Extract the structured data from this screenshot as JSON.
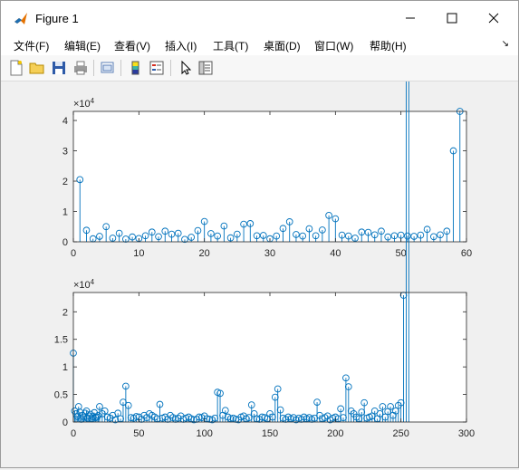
{
  "window": {
    "title": "Figure 1"
  },
  "menu": [
    "文件(F)",
    "编辑(E)",
    "查看(V)",
    "插入(I)",
    "工具(T)",
    "桌面(D)",
    "窗口(W)",
    "帮助(H)"
  ],
  "toolbar": [
    "new-figure-icon",
    "open-file-icon",
    "save-icon",
    "print-icon",
    "link-plot-icon",
    "colorbar-icon",
    "legend-icon",
    "pointer-icon",
    "property-inspector-icon"
  ],
  "colors": {
    "series": "#0072bd",
    "axes_bg": "#ffffff",
    "figure_bg": "#f0f0f0"
  },
  "chart_data": [
    {
      "type": "stem",
      "exponent_label": "×10",
      "exponent_power": "4",
      "xlim": [
        0,
        60
      ],
      "ylim": [
        0,
        43000
      ],
      "xticks": [
        0,
        10,
        20,
        30,
        40,
        50,
        60
      ],
      "yticks": [
        0,
        10000,
        20000,
        30000,
        40000
      ],
      "xtick_labels": [
        "0",
        "10",
        "20",
        "30",
        "40",
        "50",
        "60"
      ],
      "ytick_labels": [
        "0",
        "1",
        "2",
        "3",
        "4"
      ],
      "x": [
        1,
        2,
        3,
        4,
        5,
        6,
        7,
        8,
        9,
        10,
        11,
        12,
        13,
        14,
        15,
        16,
        17,
        18,
        19,
        20,
        21,
        22,
        23,
        24,
        25,
        26,
        27,
        28,
        29,
        30,
        31,
        32,
        33,
        34,
        35,
        36,
        37,
        38,
        39,
        40,
        41,
        42,
        43,
        44,
        45,
        46,
        47,
        48,
        49,
        50,
        51,
        52,
        53,
        54,
        55,
        56,
        57,
        58,
        59
      ],
      "y": [
        20500,
        3800,
        1000,
        1800,
        5000,
        1200,
        2800,
        900,
        1600,
        1100,
        2000,
        3200,
        1700,
        3500,
        2500,
        2800,
        800,
        1500,
        3700,
        6700,
        2700,
        1900,
        5200,
        1300,
        2500,
        5800,
        6000,
        2000,
        2100,
        1000,
        1900,
        4400,
        6600,
        2400,
        1900,
        4300,
        2000,
        3900,
        8700,
        7600,
        2200,
        1900,
        1200,
        3200,
        3100,
        2300,
        3500,
        1600,
        2000,
        2200,
        1900,
        1800,
        2200,
        4100,
        1700,
        2300,
        3500,
        30000,
        43000
      ]
    },
    {
      "type": "stem",
      "exponent_label": "×10",
      "exponent_power": "4",
      "xlim": [
        0,
        300
      ],
      "ylim": [
        0,
        23500
      ],
      "xticks": [
        0,
        50,
        100,
        150,
        200,
        250,
        300
      ],
      "yticks": [
        0,
        5000,
        10000,
        15000,
        20000
      ],
      "xtick_labels": [
        "0",
        "50",
        "100",
        "150",
        "200",
        "250",
        "300"
      ],
      "ytick_labels": [
        "0",
        "0.5",
        "1",
        "1.5",
        "2"
      ],
      "x": [
        0,
        1,
        2,
        3,
        4,
        5,
        6,
        7,
        8,
        9,
        10,
        11,
        12,
        13,
        14,
        15,
        16,
        17,
        18,
        19,
        20,
        22,
        24,
        26,
        28,
        30,
        32,
        34,
        36,
        38,
        40,
        42,
        44,
        46,
        48,
        50,
        52,
        54,
        56,
        58,
        60,
        62,
        64,
        66,
        68,
        70,
        72,
        74,
        76,
        78,
        80,
        82,
        84,
        86,
        88,
        90,
        92,
        94,
        96,
        98,
        100,
        102,
        104,
        106,
        108,
        110,
        112,
        114,
        116,
        118,
        120,
        122,
        124,
        126,
        128,
        130,
        132,
        134,
        136,
        138,
        140,
        142,
        144,
        146,
        148,
        150,
        152,
        154,
        156,
        158,
        160,
        162,
        164,
        166,
        168,
        170,
        172,
        174,
        176,
        178,
        180,
        182,
        184,
        186,
        188,
        190,
        192,
        194,
        196,
        198,
        200,
        202,
        204,
        206,
        208,
        210,
        212,
        214,
        216,
        218,
        220,
        222,
        224,
        226,
        228,
        230,
        232,
        234,
        236,
        238,
        240,
        242,
        244,
        246,
        248,
        250,
        252,
        254,
        256
      ],
      "y": [
        12500,
        2000,
        1500,
        1000,
        2800,
        1800,
        500,
        1200,
        900,
        1600,
        2000,
        700,
        1100,
        1400,
        600,
        1000,
        1700,
        800,
        900,
        1200,
        2800,
        1500,
        2000,
        900,
        700,
        1200,
        400,
        1600,
        600,
        3600,
        6500,
        3000,
        800,
        700,
        1000,
        900,
        500,
        1200,
        800,
        1500,
        1200,
        900,
        600,
        3200,
        700,
        900,
        500,
        1200,
        800,
        500,
        700,
        1100,
        500,
        700,
        900,
        600,
        400,
        500,
        900,
        800,
        1100,
        600,
        500,
        400,
        700,
        5400,
        5200,
        1200,
        2100,
        900,
        600,
        700,
        500,
        400,
        900,
        1100,
        600,
        800,
        3100,
        1500,
        600,
        500,
        900,
        800,
        600,
        1500,
        900,
        4500,
        6000,
        2200,
        700,
        500,
        900,
        600,
        800,
        400,
        700,
        500,
        900,
        600,
        800,
        500,
        700,
        3600,
        1200,
        600,
        800,
        1100,
        400,
        700,
        900,
        600,
        2400,
        800,
        8000,
        6400,
        2000,
        1500,
        900,
        600,
        1800,
        3500,
        700,
        900,
        1100,
        2000,
        600,
        1500,
        2800,
        900,
        1900,
        2800,
        1200,
        2000,
        3000,
        3500,
        23000
      ]
    }
  ]
}
